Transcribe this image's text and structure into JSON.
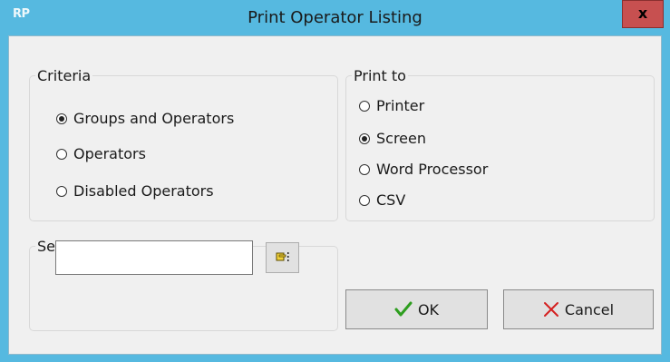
{
  "window": {
    "app_icon_text": "RP",
    "title": "Print Operator Listing",
    "close_label": "x"
  },
  "criteria": {
    "legend": "Criteria",
    "options": [
      {
        "label": "Groups and Operators",
        "selected": true
      },
      {
        "label": "Operators",
        "selected": false
      },
      {
        "label": "Disabled Operators",
        "selected": false
      }
    ]
  },
  "print_to": {
    "legend": "Print to",
    "options": [
      {
        "label": "Printer",
        "selected": false
      },
      {
        "label": "Screen",
        "selected": true
      },
      {
        "label": "Word Processor",
        "selected": false
      },
      {
        "label": "CSV",
        "selected": false
      }
    ]
  },
  "select_group": {
    "legend": "Select Group",
    "value": ""
  },
  "buttons": {
    "ok_label": "OK",
    "cancel_label": "Cancel"
  },
  "colors": {
    "titlebar": "#56b9e0",
    "close": "#c75050",
    "ok_check": "#2e9e1f",
    "cancel_x": "#d42020"
  }
}
